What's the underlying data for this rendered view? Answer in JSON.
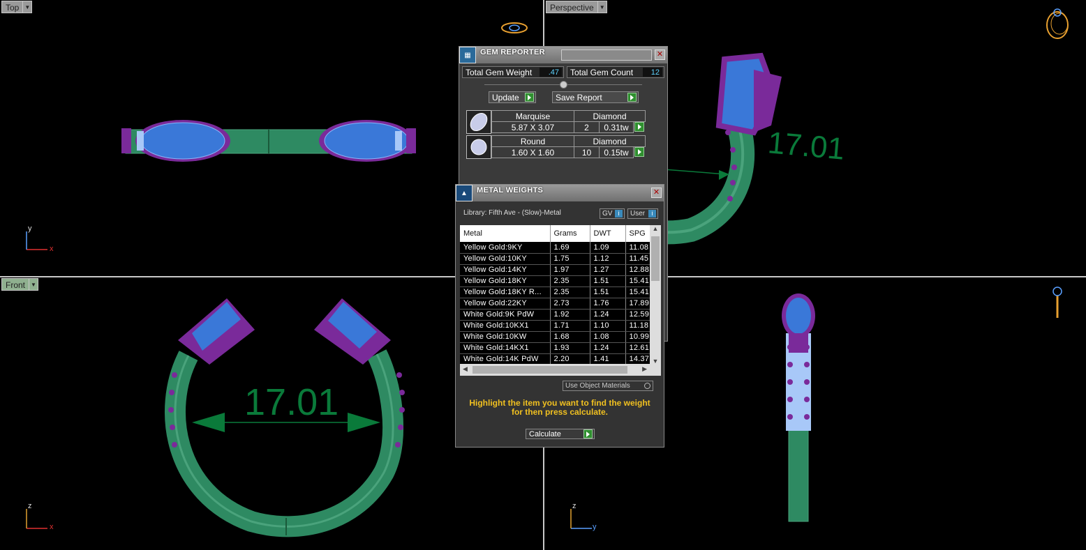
{
  "viewports": {
    "top": {
      "label": "Top",
      "axis_v": "y",
      "axis_h": "x"
    },
    "perspective": {
      "label": "Perspective"
    },
    "front": {
      "label": "Front",
      "axis_v": "z",
      "axis_h": "x",
      "dimension": "17.01"
    },
    "side": {
      "axis_v": "z",
      "axis_h": "y"
    },
    "perspective_dimension": "17.01"
  },
  "gem_reporter": {
    "title": "GEM REPORTER",
    "total_weight_label": "Total Gem Weight",
    "total_weight_value": ".47",
    "total_count_label": "Total Gem Count",
    "total_count_value": "12",
    "update_label": "Update",
    "save_report_label": "Save Report",
    "gems": [
      {
        "shape": "Marquise",
        "material": "Diamond",
        "size": "5.87 X 3.07",
        "count": "2",
        "weight": "0.31tw"
      },
      {
        "shape": "Round",
        "material": "Diamond",
        "size": "1.60 X 1.60",
        "count": "10",
        "weight": "0.15tw"
      }
    ]
  },
  "metal_weights": {
    "title": "METAL WEIGHTS",
    "library": "Library: Fifth Ave - (Slow)-Metal",
    "gv_label": "GV",
    "user_label": "User",
    "columns": [
      "Metal",
      "Grams",
      "DWT",
      "SPG"
    ],
    "rows": [
      [
        "Yellow Gold:9KY",
        "1.69",
        "1.09",
        "11.08"
      ],
      [
        "Yellow Gold:10KY",
        "1.75",
        "1.12",
        "11.45"
      ],
      [
        "Yellow Gold:14KY",
        "1.97",
        "1.27",
        "12.88"
      ],
      [
        "Yellow Gold:18KY",
        "2.35",
        "1.51",
        "15.41"
      ],
      [
        "Yellow Gold:18KY R...",
        "2.35",
        "1.51",
        "15.41"
      ],
      [
        "Yellow Gold:22KY",
        "2.73",
        "1.76",
        "17.89"
      ],
      [
        "White Gold:9K PdW",
        "1.92",
        "1.24",
        "12.59"
      ],
      [
        "White Gold:10KX1",
        "1.71",
        "1.10",
        "11.18"
      ],
      [
        "White Gold:10KW",
        "1.68",
        "1.08",
        "10.99"
      ],
      [
        "White Gold:14KX1",
        "1.93",
        "1.24",
        "12.61"
      ],
      [
        "White Gold:14K PdW",
        "2.20",
        "1.41",
        "14.37"
      ]
    ],
    "use_object_materials_label": "Use Object Materials",
    "note": "Highlight the item you want to find the weight for then press calculate.",
    "calculate_label": "Calculate"
  },
  "colors": {
    "band": "#2e8a62",
    "band_light": "#4aa37c",
    "prong": "#7a2a9a",
    "gem": "#3a78d8",
    "small_gem": "#a8c8f8",
    "dimension": "#0a7a3a",
    "axis_x": "#e03030",
    "axis_y": "#5aa0ff",
    "axis_z": "#e0a030"
  }
}
